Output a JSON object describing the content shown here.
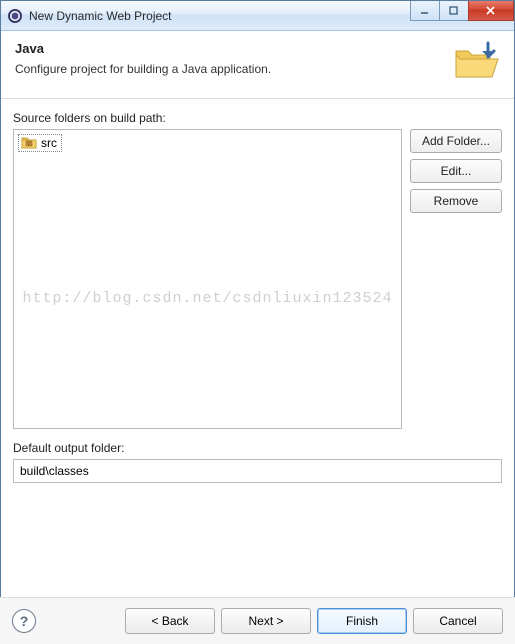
{
  "titlebar": {
    "title": "New Dynamic Web Project"
  },
  "header": {
    "title": "Java",
    "description": "Configure project for building a Java application."
  },
  "source": {
    "label": "Source folders on build path:",
    "folders": [
      {
        "name": "src"
      }
    ],
    "buttons": {
      "add": "Add Folder...",
      "edit": "Edit...",
      "remove": "Remove"
    }
  },
  "output": {
    "label": "Default output folder:",
    "value": "build\\classes"
  },
  "watermark": "http://blog.csdn.net/csdnliuxin123524",
  "footer": {
    "back": "< Back",
    "next": "Next >",
    "finish": "Finish",
    "cancel": "Cancel"
  }
}
